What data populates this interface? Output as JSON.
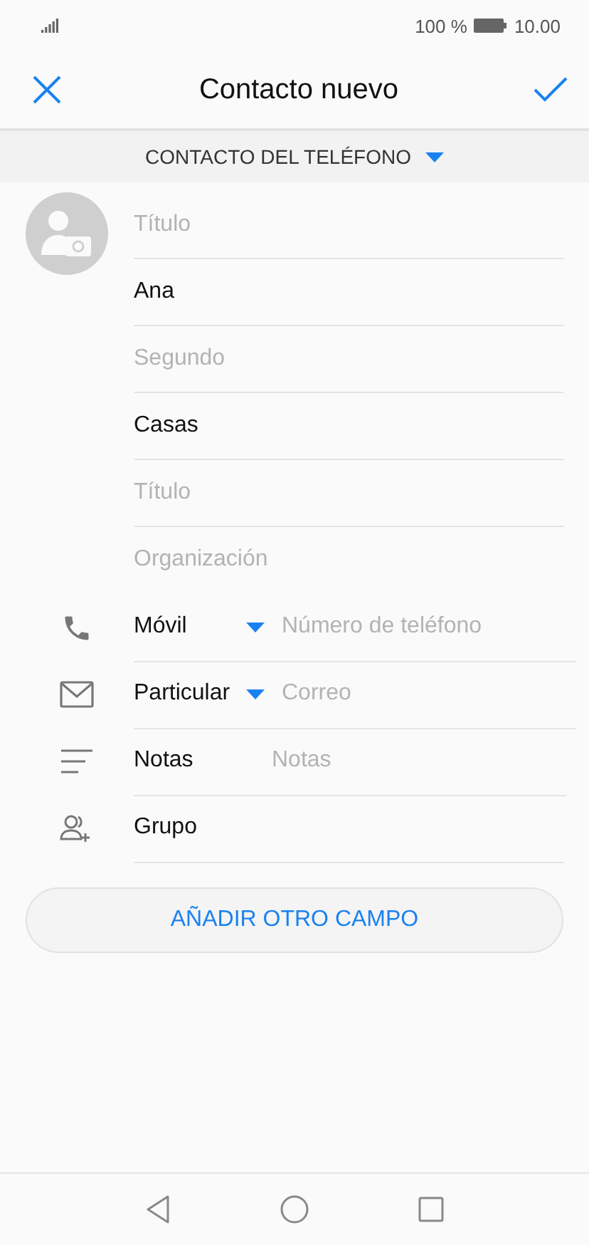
{
  "status_bar": {
    "battery": "100 %",
    "time": "10.00"
  },
  "header": {
    "title": "Contacto nuevo"
  },
  "account": {
    "label": "CONTACTO DEL TELÉFONO"
  },
  "name_fields": [
    {
      "placeholder": "Título"
    },
    {
      "value": "Ana"
    },
    {
      "placeholder": "Segundo"
    },
    {
      "value": "Casas"
    },
    {
      "placeholder": "Título"
    },
    {
      "placeholder": "Organización"
    }
  ],
  "typed_fields": [
    {
      "kind": "dropdown",
      "label": "Móvil",
      "placeholder": "Número de teléfono"
    },
    {
      "kind": "dropdown",
      "label": "Particular",
      "placeholder": "Correo"
    },
    {
      "kind": "label",
      "label": "Notas",
      "placeholder": "Notas"
    },
    {
      "kind": "label",
      "label": "Grupo"
    }
  ],
  "add_button": "AÑADIR OTRO CAMPO"
}
